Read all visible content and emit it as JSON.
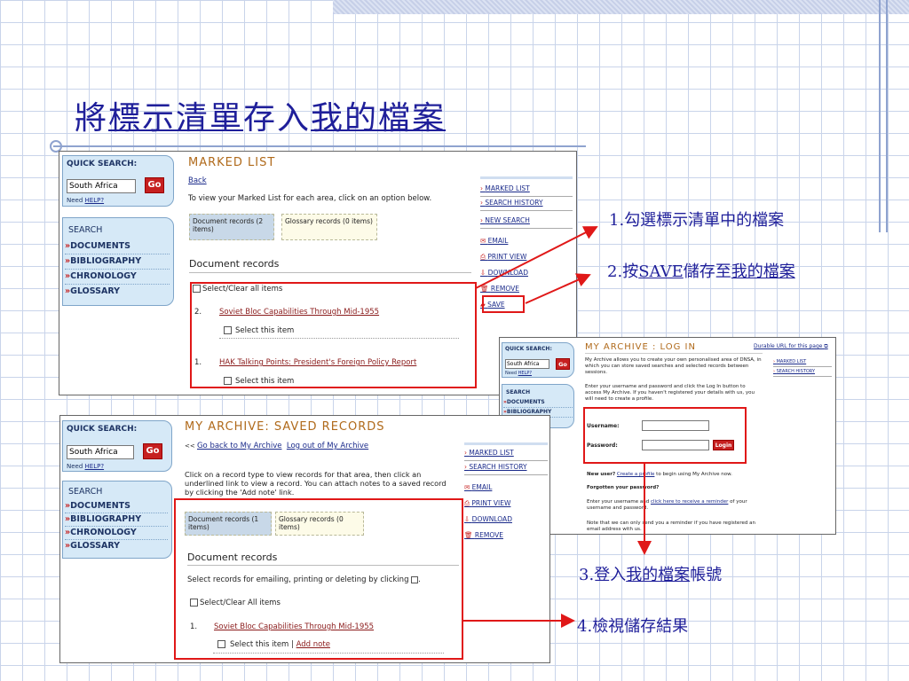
{
  "slide": {
    "title_parts": [
      "將",
      "標示清單",
      "存入",
      "我的檔案"
    ],
    "annotations": [
      {
        "num": "1.",
        "text": "勾選標示清單中的檔案"
      },
      {
        "num": "2.",
        "pre": "按",
        "save": "SAVE",
        "mid": "儲存至",
        "archive": "我的檔案"
      },
      {
        "num": "3.",
        "pre": "登入",
        "archive": "我的檔案",
        "post": "帳號"
      },
      {
        "num": "4.",
        "text": "檢視儲存結果"
      }
    ]
  },
  "colors": {
    "accent": "#1f1f9a",
    "highlight": "#e01818",
    "go": "#c62020",
    "page_title": "#b06a1b"
  },
  "quick_search": {
    "label": "QUICK SEARCH:",
    "value": "South Africa",
    "go": "Go",
    "need": "Need ",
    "help": "HELP?"
  },
  "side_menu": {
    "heading": "SEARCH",
    "items": [
      {
        "label": "DOCUMENTS"
      },
      {
        "label": "BIBLIOGRAPHY"
      },
      {
        "label": "CHRONOLOGY"
      },
      {
        "label": "GLOSSARY"
      }
    ]
  },
  "marked": {
    "title": "MARKED LIST",
    "back": "Back",
    "intro": "To view your Marked List for each area, click on an option below.",
    "tabs": [
      {
        "label": "Document records (2 items)"
      },
      {
        "label": "Glossary records (0 items)"
      }
    ],
    "section": "Document records",
    "select_all": "Select/Clear all items",
    "records": [
      {
        "num": "2.",
        "title": "Soviet Bloc Capabilities Through Mid-1955",
        "select": "Select this item"
      },
      {
        "num": "1.",
        "title": "HAK Talking Points: President's Foreign Policy Report",
        "select": "Select this item"
      }
    ],
    "right_menu": {
      "nav": [
        {
          "label": "MARKED LIST"
        },
        {
          "label": "SEARCH HISTORY"
        },
        {
          "label": "NEW SEARCH"
        }
      ],
      "actions": [
        {
          "icon": "email-icon",
          "label": "EMAIL"
        },
        {
          "icon": "printer-icon",
          "label": "PRINT VIEW"
        },
        {
          "icon": "download-icon",
          "label": "DOWNLOAD"
        },
        {
          "icon": "trash-icon",
          "label": "REMOVE"
        },
        {
          "icon": "folder-icon",
          "label": "SAVE"
        }
      ]
    }
  },
  "login": {
    "title": "MY ARCHIVE : LOG IN",
    "durable": "Durable URL for this page",
    "intro": "My Archive allows you to create your own personalised area of DNSA, in which you can store saved searches and selected records between sessions.",
    "intro2": "Enter your username and password and click the Log In button to access My Archive. If you haven't registered your details with us, you will need to create a profile.",
    "username": "Username:",
    "password": "Password:",
    "login_btn": "Login",
    "new_user_bold": "New user?",
    "create_link": "Create a profile",
    "new_user_tail": " to begin using My Archive now.",
    "forgot": "Forgotten your password?",
    "reminder_pre": "Enter your username and ",
    "reminder_link": "click here to receive a reminder",
    "reminder_post": " of your username and password.",
    "note": "Note that we can only send you a reminder if you have registered an email address with us.",
    "nav": [
      {
        "label": "MARKED LIST"
      },
      {
        "label": "SEARCH HISTORY"
      }
    ]
  },
  "saved": {
    "title": "MY ARCHIVE: SAVED RECORDS",
    "back_arrow": "<< ",
    "back": "Go back to My Archive",
    "logout": "Log out of My Archive",
    "intro": "Click on a record type to view records for that area, then click an underlined link to view a record. You can attach notes to a saved record by clicking the 'Add note' link.",
    "tabs": [
      {
        "label": "Document records (1 items)"
      },
      {
        "label": "Glossary records (0 items)"
      }
    ],
    "section": "Document records",
    "select_text": "Select records for emailing, printing or deleting by clicking ",
    "select_all": "Select/Clear All items",
    "record": {
      "num": "1.",
      "title": "Soviet Bloc Capabilities Through Mid-1955",
      "select": "Select this item",
      "sep": "|",
      "note": "Add note"
    },
    "right_menu": {
      "nav": [
        {
          "label": "MARKED LIST"
        },
        {
          "label": "SEARCH HISTORY"
        }
      ],
      "actions": [
        {
          "icon": "email-icon",
          "label": "EMAIL"
        },
        {
          "icon": "printer-icon",
          "label": "PRINT VIEW"
        },
        {
          "icon": "download-icon",
          "label": "DOWNLOAD"
        },
        {
          "icon": "trash-icon",
          "label": "REMOVE"
        }
      ]
    }
  }
}
